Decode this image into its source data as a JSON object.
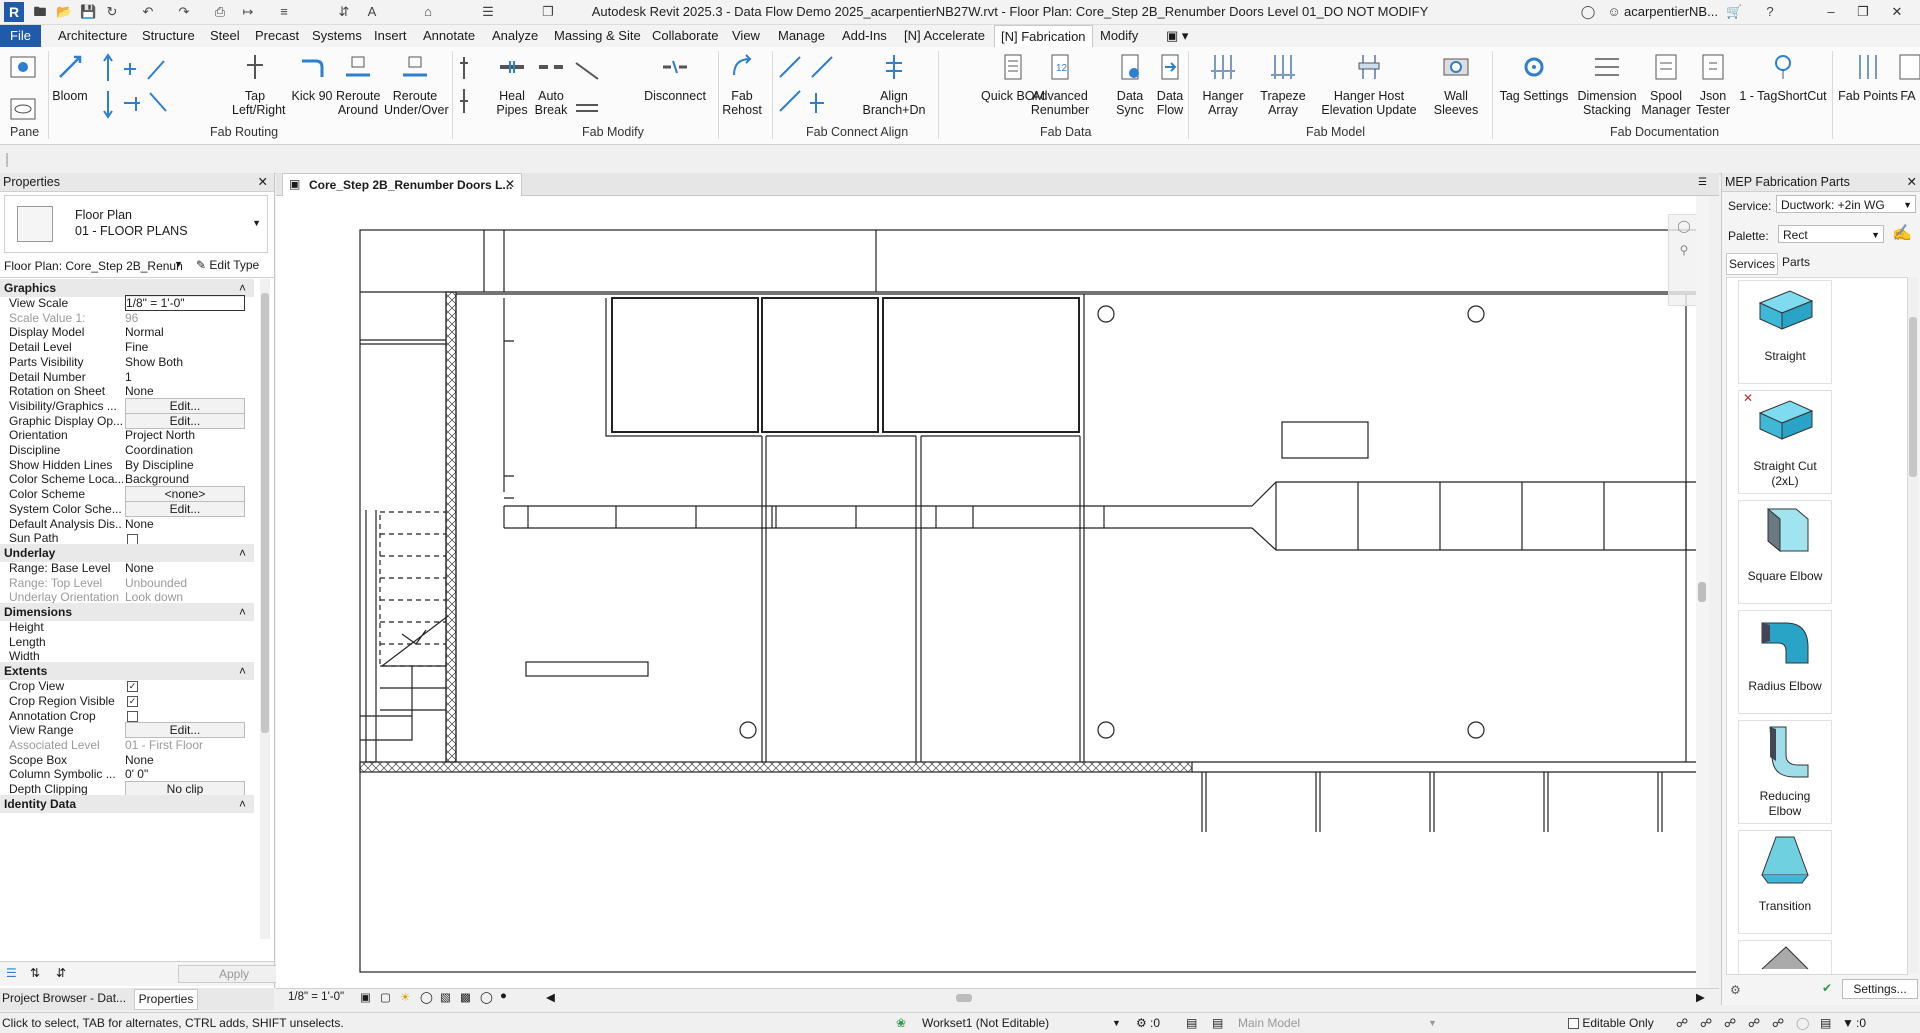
{
  "titlebar": {
    "app_letter": "R",
    "title": "Autodesk Revit 2025.3 - Data Flow Demo 2025_acarpentierNB27W.rvt - Floor Plan: Core_Step 2B_Renumber Doors Level 01_DO NOT MODIFY",
    "user": "acarpentierNB...",
    "minimize": "–",
    "restore": "❐",
    "close": "✕"
  },
  "menu": {
    "tabs": [
      "File",
      "Architecture",
      "Structure",
      "Steel",
      "Precast",
      "Systems",
      "Insert",
      "Annotate",
      "Analyze",
      "Massing & Site",
      "Collaborate",
      "View",
      "Manage",
      "Add-Ins",
      "[N] Accelerate",
      "[N] Fabrication",
      "Modify"
    ],
    "active": "[N] Fabrication"
  },
  "ribbon": {
    "buttons": [
      {
        "id": "bloom",
        "label": "Bloom"
      },
      {
        "id": "tap",
        "label": "Tap\nLeft/Right"
      },
      {
        "id": "kick90",
        "label": "Kick 90"
      },
      {
        "id": "reroute-around",
        "label": "Reroute\nAround"
      },
      {
        "id": "reroute-under",
        "label": "Reroute\nUnder/Over"
      },
      {
        "id": "heal-pipes",
        "label": "Heal\nPipes"
      },
      {
        "id": "auto-break",
        "label": "Auto\nBreak"
      },
      {
        "id": "disconnect",
        "label": "Disconnect"
      },
      {
        "id": "fab-rehost",
        "label": "Fab\nRehost"
      },
      {
        "id": "align-branch",
        "label": "Align\nBranch+Dn"
      },
      {
        "id": "quick-bom",
        "label": "Quick BOM"
      },
      {
        "id": "advanced-renumber",
        "label": "Advanced\nRenumber"
      },
      {
        "id": "data-sync",
        "label": "Data\nSync"
      },
      {
        "id": "data-flow",
        "label": "Data\nFlow"
      },
      {
        "id": "hanger-array",
        "label": "Hanger\nArray"
      },
      {
        "id": "trapeze-array",
        "label": "Trapeze\nArray"
      },
      {
        "id": "hanger-host",
        "label": "Hanger Host\nElevation Update"
      },
      {
        "id": "wall-sleeves",
        "label": "Wall\nSleeves"
      },
      {
        "id": "tag-settings",
        "label": "Tag Settings"
      },
      {
        "id": "dimension-stacking",
        "label": "Dimension\nStacking"
      },
      {
        "id": "spool-manager",
        "label": "Spool\nManager"
      },
      {
        "id": "json-tester",
        "label": "Json\nTester"
      },
      {
        "id": "tagshortcut",
        "label": "1 - TagShortCut"
      },
      {
        "id": "fab-points",
        "label": "Fab Points"
      },
      {
        "id": "fa",
        "label": "FA"
      }
    ],
    "panels": [
      "Pane",
      "Fab Routing",
      "Fab Modify",
      "Fab Connect Align",
      "Fab Data",
      "Fab Model",
      "Fab Documentation"
    ]
  },
  "properties": {
    "title": "Properties",
    "type_name": "Floor Plan",
    "type_sub": "01 - FLOOR PLANS",
    "instance_selector": "Floor Plan: Core_Step 2B_Renun",
    "edit_type": "Edit Type",
    "sections": {
      "graphics": "Graphics",
      "underlay": "Underlay",
      "dimensions": "Dimensions",
      "extents": "Extents",
      "identity": "Identity Data"
    },
    "graphics_rows": [
      {
        "k": "View Scale",
        "v": "1/8\" = 1'-0\""
      },
      {
        "k": "Scale Value    1:",
        "v": "96"
      },
      {
        "k": "Display Model",
        "v": "Normal"
      },
      {
        "k": "Detail Level",
        "v": "Fine"
      },
      {
        "k": "Parts Visibility",
        "v": "Show Both"
      },
      {
        "k": "Detail Number",
        "v": "1"
      },
      {
        "k": "Rotation on Sheet",
        "v": "None"
      },
      {
        "k": "Visibility/Graphics ...",
        "v": "Edit..."
      },
      {
        "k": "Graphic Display Op...",
        "v": "Edit..."
      },
      {
        "k": "Orientation",
        "v": "Project North"
      },
      {
        "k": "Discipline",
        "v": "Coordination"
      },
      {
        "k": "Show Hidden Lines",
        "v": "By Discipline"
      },
      {
        "k": "Color Scheme Loca...",
        "v": "Background"
      },
      {
        "k": "Color Scheme",
        "v": "<none>"
      },
      {
        "k": "System Color Sche...",
        "v": "Edit..."
      },
      {
        "k": "Default Analysis Dis...",
        "v": "None"
      },
      {
        "k": "Sun Path",
        "v": ""
      }
    ],
    "underlay_rows": [
      {
        "k": "Range: Base Level",
        "v": "None"
      },
      {
        "k": "Range: Top Level",
        "v": "Unbounded"
      },
      {
        "k": "Underlay Orientation",
        "v": "Look down"
      }
    ],
    "dimension_rows": [
      {
        "k": "Height",
        "v": ""
      },
      {
        "k": "Length",
        "v": ""
      },
      {
        "k": "Width",
        "v": ""
      }
    ],
    "extents_rows": [
      {
        "k": "Crop View",
        "v": ""
      },
      {
        "k": "Crop Region Visible",
        "v": ""
      },
      {
        "k": "Annotation Crop",
        "v": ""
      },
      {
        "k": "View Range",
        "v": "Edit..."
      },
      {
        "k": "Associated Level",
        "v": "01 - First Floor"
      },
      {
        "k": "Scope Box",
        "v": "None"
      },
      {
        "k": "Column Symbolic ...",
        "v": "0'  0\""
      },
      {
        "k": "Depth Clipping",
        "v": "No clip"
      }
    ],
    "apply": "Apply",
    "tab_browser": "Project Browser - Dat...",
    "tab_properties": "Properties"
  },
  "view": {
    "tab_label": "Core_Step 2B_Renumber Doors L...",
    "scale_label": "1/8\" = 1'-0\""
  },
  "mep": {
    "title": "MEP Fabrication Parts",
    "service_label": "Service:",
    "service_value": "Ductwork: +2in WG",
    "palette_label": "Palette:",
    "palette_value": "Rect",
    "tabs": [
      "Services",
      "Parts"
    ],
    "parts": [
      "Straight",
      "Straight Cut\n(2xL)",
      "Square Elbow",
      "Radius Elbow",
      "Reducing\nElbow",
      "Transition"
    ],
    "settings": "Settings..."
  },
  "status": {
    "hint": "Click to select, TAB for alternates, CTRL adds, SHIFT unselects.",
    "workset": "Workset1 (Not Editable)",
    "count": ":0",
    "model": "Main Model",
    "editable_only": "Editable Only",
    "filter_count": ":0"
  },
  "colors": {
    "file_tab": "#1f5ba8",
    "duct_blue": "#3fb8d8"
  }
}
